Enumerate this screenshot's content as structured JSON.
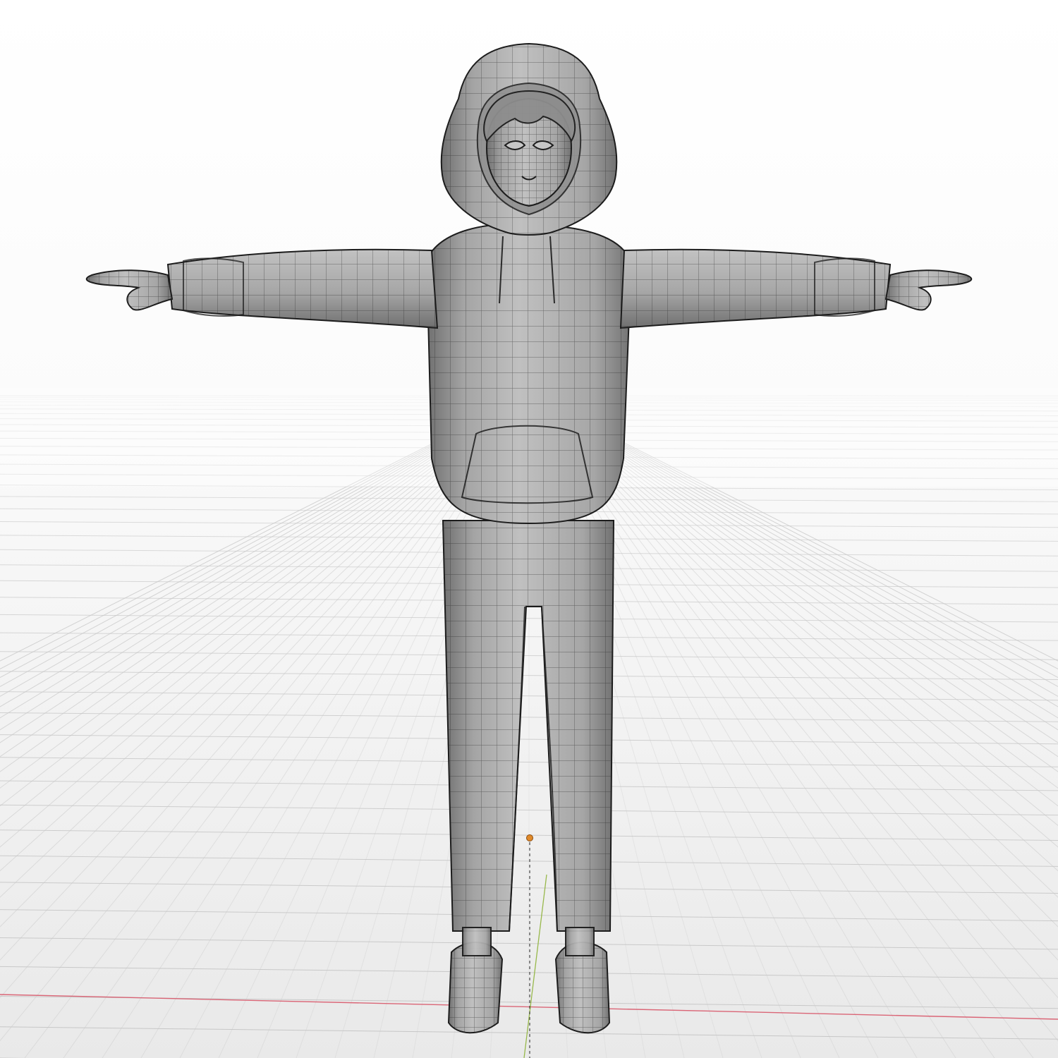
{
  "viewport": {
    "kind": "3d-viewport",
    "shading": "solid",
    "overlay": "wireframe"
  },
  "colors": {
    "background_top": "#ffffff",
    "background_bottom": "#e9e9e9",
    "grid_line": "#c7c7c7",
    "mesh_fill_light": "#b4b4b4",
    "mesh_fill_dark": "#6e6e6e",
    "wire": "#1d1d1d",
    "x_axis": "#d9576a",
    "y_axis": "#8fb33a",
    "origin": "#e08a2a"
  },
  "scene": {
    "objects": [
      {
        "name": "character",
        "type": "mesh",
        "parts": [
          "hood",
          "head",
          "hair",
          "hoodie",
          "left-arm",
          "right-arm",
          "left-hand",
          "right-hand",
          "pants",
          "left-shoe",
          "right-shoe"
        ]
      }
    ],
    "origin_marker": "origin-point",
    "axes": [
      "x-axis-line",
      "y-axis-line"
    ]
  }
}
